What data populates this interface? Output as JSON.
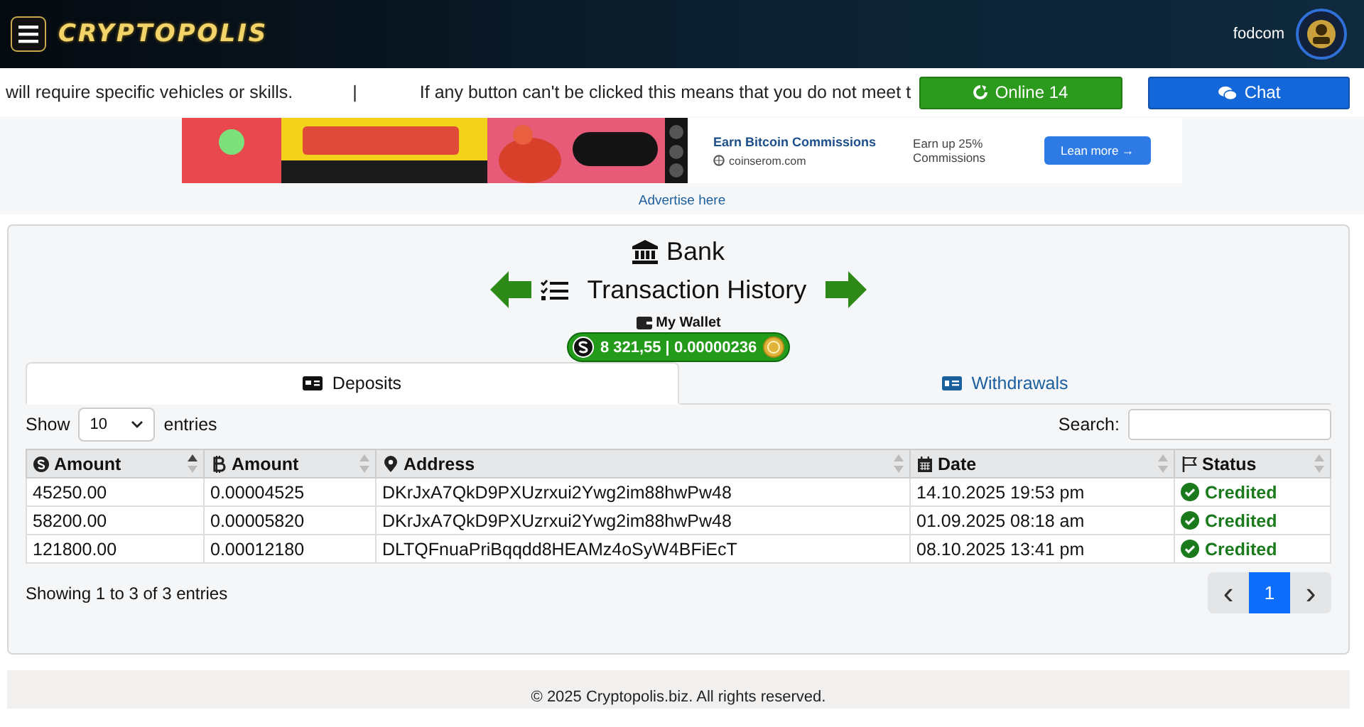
{
  "header": {
    "logo": "CRYPTOPOLIS",
    "username": "fodcom"
  },
  "ticker": {
    "text": "will require specific vehicles or skills.",
    "separator": "|",
    "text_2": "If any button can't be clicked this means that you do not meet t"
  },
  "online_button": {
    "label": "Online 14"
  },
  "chat_button": {
    "label": "Chat"
  },
  "ad": {
    "kind": "picture",
    "title": "Earn Bitcoin Commissions",
    "domain": "coinserom.com",
    "note": "Earn up 25% Commissions",
    "button": "Lean more →"
  },
  "advertise_link": "Advertise here",
  "bank": {
    "title": "Bank",
    "subtitle": "Transaction History",
    "wallet_label": "My Wallet",
    "balance": "8 321,55 | 0.00000236"
  },
  "tabs": [
    {
      "label": "Deposits",
      "selected": true
    },
    {
      "label": "Withdrawals",
      "selected": false
    }
  ],
  "length": {
    "show": "Show",
    "value": "10",
    "entries": "entries"
  },
  "search": {
    "label": "Search:"
  },
  "table": {
    "columns": [
      {
        "label": "Amount",
        "sorted": true
      },
      {
        "label": "Amount",
        "sorted": false
      },
      {
        "label": "Address",
        "sorted": false
      },
      {
        "label": "Date",
        "sorted": false
      },
      {
        "label": "Status",
        "sorted": false
      }
    ],
    "rows": [
      {
        "cells": [
          "45250.00",
          "0.00004525",
          "DKrJxA7QkD9PXUzrxui2Ywg2im88hwPw48",
          "14.10.2025 19:53 pm"
        ],
        "status": "Credited",
        "kind": "credited"
      },
      {
        "cells": [
          "58200.00",
          "0.00005820",
          "DKrJxA7QkD9PXUzrxui2Ywg2im88hwPw48",
          "01.09.2025 08:18 am"
        ],
        "status": "Credited",
        "kind": "credited"
      },
      {
        "cells": [
          "121800.00",
          "0.00012180",
          "DLTQFnuaPriBqqdd8HEAMz4oSyW4BFiEcT",
          "08.10.2025 13:41 pm"
        ],
        "status": "Credited",
        "kind": "credited"
      }
    ]
  },
  "info": "Showing 1 to 3 of 3 entries",
  "pagination": {
    "prev": "‹",
    "pages": [
      {
        "label": "1",
        "selected": true
      }
    ],
    "next": "›"
  },
  "footer": "© 2025 Cryptopolis.biz. All rights reserved."
}
